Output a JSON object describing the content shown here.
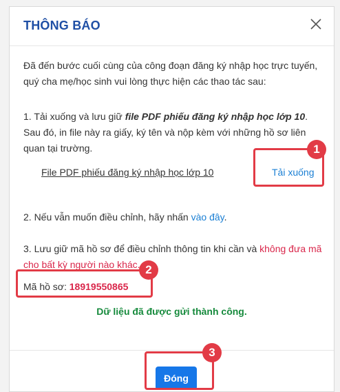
{
  "dialog": {
    "title": "THÔNG BÁO",
    "intro": "Đã đến bước cuối cùng của công đoạn đăng ký nhập học trực tuyến, quý cha mẹ/học sinh vui lòng thực hiện các thao tác sau:",
    "step1_prefix": "1. Tải xuống và lưu giữ ",
    "step1_emphasis": "file PDF phiếu đăng ký nhập học lớp 10",
    "step1_suffix": ". Sau đó, in file này ra giấy, ký tên và nộp kèm với những hồ sơ liên quan tại trường.",
    "file_label": "File PDF phiếu đăng ký nhập học lớp 10",
    "download_label": "Tải xuống",
    "step2_prefix": "2. Nếu vẫn muốn điều chỉnh, hãy nhấn ",
    "step2_link": "vào đây",
    "step2_suffix": ".",
    "step3_prefix": "3. Lưu giữ mã hồ sơ để điều chỉnh thông tin khi cần và ",
    "step3_warning": "không đưa mã cho bất kỳ người nào khác.",
    "code_label": "Mã hồ sơ: ",
    "code_value": "18919550865",
    "success_message": "Dữ liệu đã được gửi thành công.",
    "close_button": "Đóng",
    "close_icon": "close-icon"
  },
  "annotations": {
    "badges": [
      "1",
      "2",
      "3"
    ],
    "color": "#e23b46"
  },
  "colors": {
    "title": "#1f4fa5",
    "link": "#1a7fd4",
    "warning": "#d9264a",
    "success": "#168a3c",
    "button": "#1677e8"
  }
}
